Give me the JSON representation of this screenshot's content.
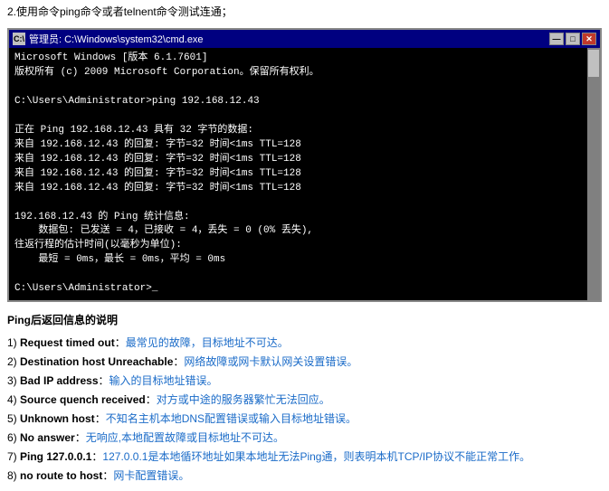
{
  "instruction": "2.使用命令ping命令或者telnent命令测试连通；",
  "cmd": {
    "titlebar": {
      "icon_text": "C:\\",
      "title": "管理员: C:\\Windows\\system32\\cmd.exe",
      "btn_min": "—",
      "btn_max": "□",
      "btn_close": "✕"
    },
    "lines": [
      {
        "text": "Microsoft Windows [版本 6.1.7601]",
        "color": "white"
      },
      {
        "text": "版权所有 (c) 2009 Microsoft Corporation。保留所有权利。",
        "color": "white"
      },
      {
        "text": ""
      },
      {
        "text": "C:\\Users\\Administrator>ping 192.168.12.43",
        "color": "white"
      },
      {
        "text": ""
      },
      {
        "text": "正在 Ping 192.168.12.43 具有 32 字节的数据:",
        "color": "white"
      },
      {
        "text": "来自 192.168.12.43 的回复: 字节=32 时间<1ms TTL=128",
        "color": "white"
      },
      {
        "text": "来自 192.168.12.43 的回复: 字节=32 时间<1ms TTL=128",
        "color": "white"
      },
      {
        "text": "来自 192.168.12.43 的回复: 字节=32 时间<1ms TTL=128",
        "color": "white"
      },
      {
        "text": "来自 192.168.12.43 的回复: 字节=32 时间<1ms TTL=128",
        "color": "white"
      },
      {
        "text": ""
      },
      {
        "text": "192.168.12.43 的 Ping 统计信息:",
        "color": "white"
      },
      {
        "text": "    数据包: 已发送 = 4，已接收 = 4，丢失 = 0 (0% 丢失),",
        "color": "white"
      },
      {
        "text": "往返行程的估计时间(以毫秒为单位):",
        "color": "white"
      },
      {
        "text": "    最短 = 0ms，最长 = 0ms，平均 = 0ms",
        "color": "white"
      },
      {
        "text": ""
      },
      {
        "text": "C:\\Users\\Administrator>_",
        "color": "white"
      }
    ]
  },
  "below_title": "Ping后返回信息的说明",
  "items": [
    {
      "number": "1)",
      "label": "Request timed out",
      "separator": "：",
      "desc": "最常见的故障，目标地址不可达。"
    },
    {
      "number": "2)",
      "label": "Destination host Unreachable",
      "separator": "：",
      "desc": "网络故障或网卡默认网关设置错误。"
    },
    {
      "number": "3)",
      "label": "Bad IP address",
      "separator": "：",
      "desc": "输入的目标地址错误。"
    },
    {
      "number": "4)",
      "label": "Source quench received",
      "separator": "：",
      "desc": "对方或中途的服务器繁忙无法回应。"
    },
    {
      "number": "5)",
      "label": "Unknown host",
      "separator": "：",
      "desc": "不知名主机本地DNS配置错误或输入目标地址错误。"
    },
    {
      "number": "6)",
      "label": "No answer",
      "separator": "：",
      "desc": "无响应,本地配置故障或目标地址不可达。"
    },
    {
      "number": "7)",
      "label": "Ping 127.0.0.1",
      "separator": "：",
      "desc": "127.0.0.1是本地循环地址如果本地址无法Ping通，则表明本机TCP/IP协议不能正常工作。"
    },
    {
      "number": "8)",
      "label": "no route to host",
      "separator": "：",
      "desc": "网卡配置错误。"
    }
  ]
}
